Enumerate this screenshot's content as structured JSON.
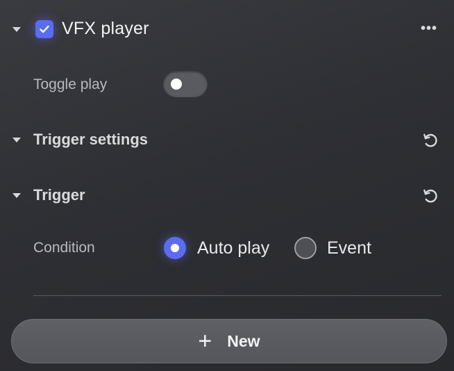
{
  "panel": {
    "title": "VFX player",
    "enabled": true,
    "more_label": "•••",
    "toggle_play": {
      "label": "Toggle play",
      "on": false
    }
  },
  "sections": {
    "trigger_settings": {
      "title": "Trigger settings"
    },
    "trigger": {
      "title": "Trigger",
      "condition_label": "Condition",
      "options": [
        {
          "label": "Auto play",
          "selected": true
        },
        {
          "label": "Event",
          "selected": false
        }
      ]
    }
  },
  "new_button": {
    "icon": "plus-icon",
    "label": "New"
  },
  "colors": {
    "accent": "#5b6cf0",
    "background": "#2e2f34"
  }
}
